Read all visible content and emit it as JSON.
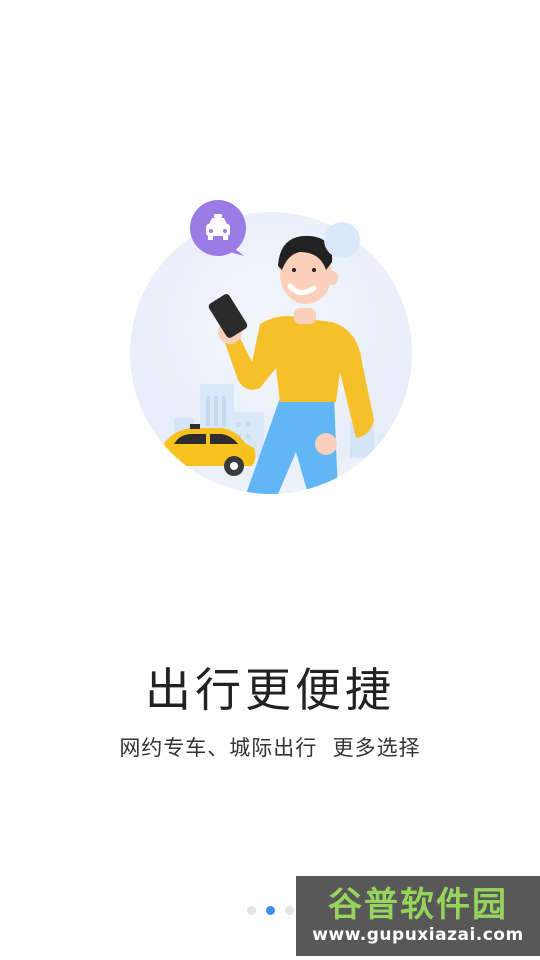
{
  "onboarding": {
    "title": "出行更便捷",
    "subtitle": "网约专车、城际出行  更多选择",
    "page_count": 3,
    "current_page": 2
  },
  "icons": {
    "taxi_bubble": "taxi-icon"
  },
  "colors": {
    "accent": "#3b8ff4",
    "dot_inactive": "#e4e4e4",
    "bubble_purple": "#9b7be6",
    "shirt_yellow": "#f6c02b",
    "pants_blue": "#63b6f6",
    "car_yellow": "#f7c21d"
  },
  "watermark": {
    "title": "谷普软件园",
    "url": "www.gupuxiazai.com"
  }
}
